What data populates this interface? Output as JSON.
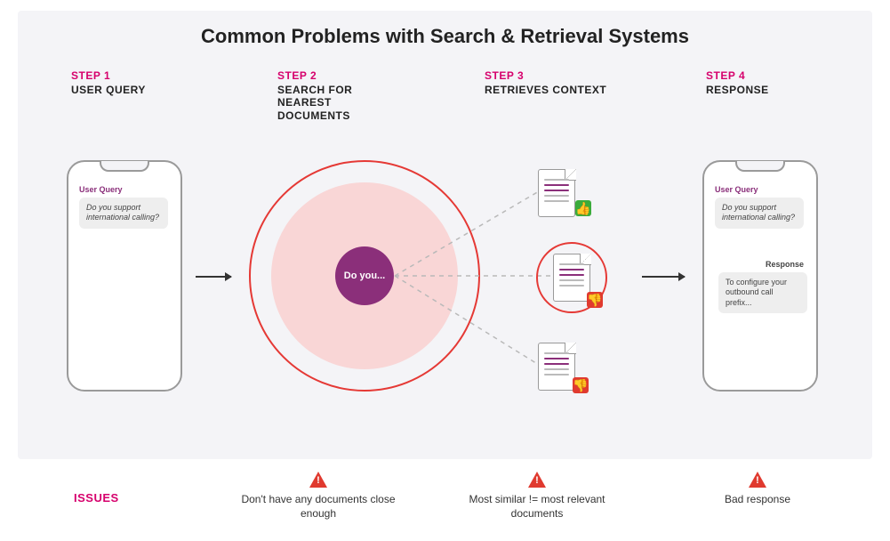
{
  "title": "Common Problems with Search & Retrieval Systems",
  "steps": [
    {
      "num": "STEP 1",
      "txt": "USER QUERY"
    },
    {
      "num": "STEP 2",
      "txt": "SEARCH FOR\nNEAREST\nDOCUMENTS"
    },
    {
      "num": "STEP 3",
      "txt": "RETRIEVES CONTEXT"
    },
    {
      "num": "STEP 4",
      "txt": "RESPONSE"
    }
  ],
  "phone1": {
    "label": "User Query",
    "bubble": "Do you support international calling?"
  },
  "search_core": "Do you...",
  "docs": [
    {
      "thumb": "up"
    },
    {
      "thumb": "down",
      "selected": true
    },
    {
      "thumb": "down"
    }
  ],
  "phone2": {
    "query_label": "User Query",
    "query_bubble": "Do you support international calling?",
    "response_label": "Response",
    "response_bubble": "To configure your outbound call prefix..."
  },
  "issues_label": "ISSUES",
  "issues": [
    "Don't have any documents close enough",
    "Most similar != most relevant documents",
    "Bad response"
  ]
}
